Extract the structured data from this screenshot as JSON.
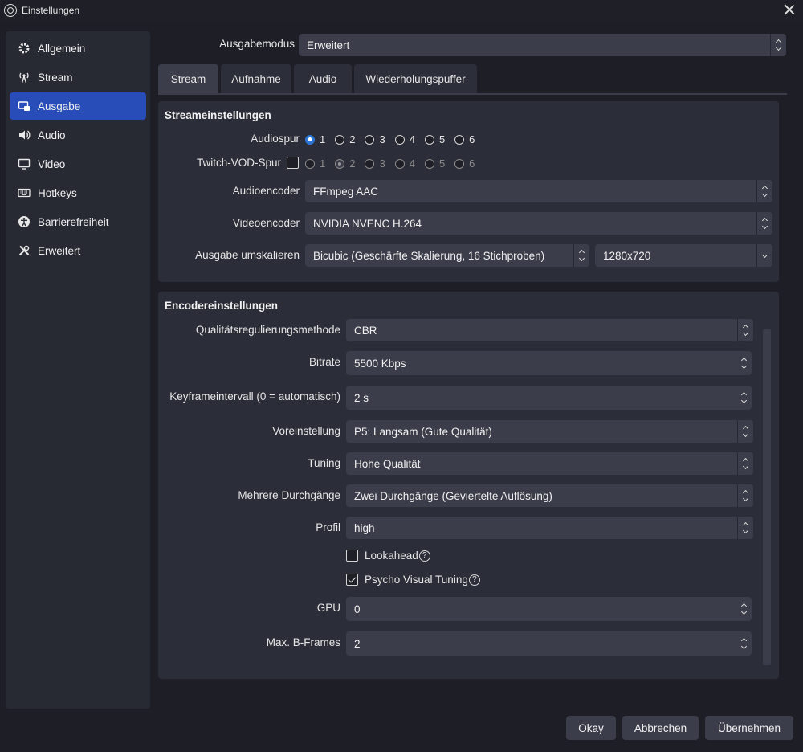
{
  "window": {
    "title": "Einstellungen"
  },
  "sidebar": {
    "items": [
      {
        "label": "Allgemein",
        "icon": "gear-icon"
      },
      {
        "label": "Stream",
        "icon": "antenna-icon"
      },
      {
        "label": "Ausgabe",
        "icon": "output-icon",
        "active": true
      },
      {
        "label": "Audio",
        "icon": "speaker-icon"
      },
      {
        "label": "Video",
        "icon": "monitor-icon"
      },
      {
        "label": "Hotkeys",
        "icon": "keyboard-icon"
      },
      {
        "label": "Barrierefreiheit",
        "icon": "accessibility-icon"
      },
      {
        "label": "Erweitert",
        "icon": "tools-icon"
      }
    ]
  },
  "output_mode": {
    "label": "Ausgabemodus",
    "value": "Erweitert"
  },
  "tabs": [
    "Stream",
    "Aufnahme",
    "Audio",
    "Wiederholungspuffer"
  ],
  "stream_settings": {
    "title": "Streameinstellungen",
    "audio_track_label": "Audiospur",
    "audio_tracks": [
      "1",
      "2",
      "3",
      "4",
      "5",
      "6"
    ],
    "audio_track_selected": "1",
    "twitch_vod_label": "Twitch-VOD-Spur",
    "twitch_vod_checked": false,
    "twitch_tracks": [
      "1",
      "2",
      "3",
      "4",
      "5",
      "6"
    ],
    "audio_encoder_label": "Audioencoder",
    "audio_encoder": "FFmpeg AAC",
    "video_encoder_label": "Videoencoder",
    "video_encoder": "NVIDIA NVENC H.264",
    "rescale_label": "Ausgabe umskalieren",
    "rescale_filter": "Bicubic (Geschärfte Skalierung, 16 Stichproben)",
    "rescale_resolution": "1280x720"
  },
  "encoder_settings": {
    "title": "Encodereinstellungen",
    "rate_control_label": "Qualitätsregulierungsmethode",
    "rate_control": "CBR",
    "bitrate_label": "Bitrate",
    "bitrate": "5500 Kbps",
    "keyframe_label": "Keyframeintervall (0 = automatisch)",
    "keyframe": "2 s",
    "preset_label": "Voreinstellung",
    "preset": "P5: Langsam (Gute Qualität)",
    "tuning_label": "Tuning",
    "tuning": "Hohe Qualität",
    "multipass_label": "Mehrere Durchgänge",
    "multipass": "Zwei Durchgänge (Geviertelte Auflösung)",
    "profile_label": "Profil",
    "profile": "high",
    "lookahead_label": "Lookahead",
    "lookahead_checked": false,
    "psycho_label": "Psycho Visual Tuning",
    "psycho_checked": true,
    "help_glyph": "?",
    "gpu_label": "GPU",
    "gpu": "0",
    "bframes_label": "Max. B-Frames",
    "bframes": "2"
  },
  "buttons": {
    "ok": "Okay",
    "cancel": "Abbrechen",
    "apply": "Übernehmen"
  },
  "colors": {
    "accent": "#284cb8",
    "radio_checked": "#2b74d8",
    "background": "#1e1f26"
  }
}
